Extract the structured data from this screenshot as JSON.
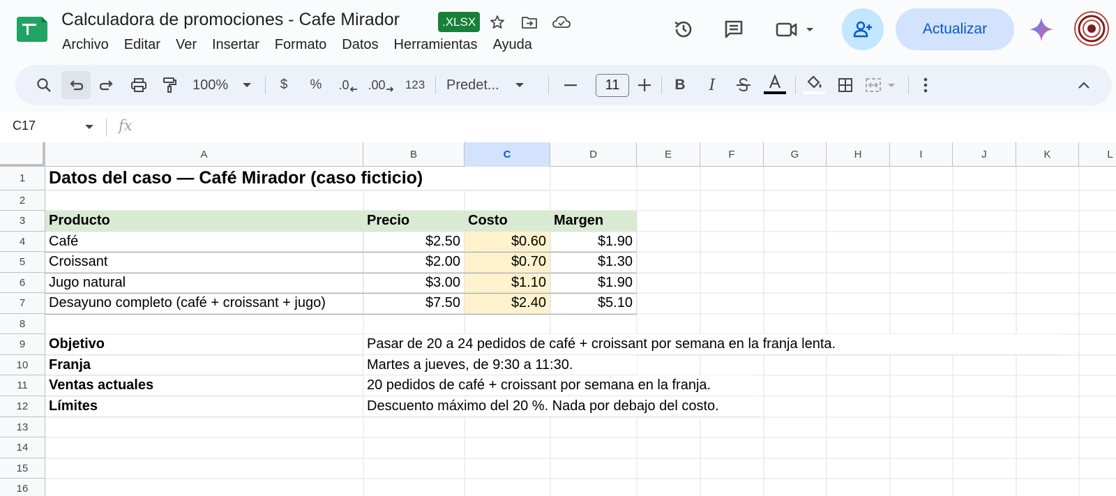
{
  "app": {
    "doc_title": "Calculadora de promociones - Cafe Mirador",
    "file_badge": ".XLSX",
    "menu": [
      "Archivo",
      "Editar",
      "Ver",
      "Insertar",
      "Formato",
      "Datos",
      "Herramientas",
      "Ayuda"
    ],
    "update_label": "Actualizar"
  },
  "toolbar": {
    "zoom": "100%",
    "currency": "$",
    "percent": "%",
    "dec_less": ".0",
    "dec_more": ".00",
    "format_123": "123",
    "font_name": "Predet...",
    "font_size": "11"
  },
  "formula_bar": {
    "name_box": "C17",
    "fx": "fx"
  },
  "sheet": {
    "columns": [
      "A",
      "B",
      "C",
      "D",
      "E",
      "F",
      "G",
      "H",
      "I",
      "J",
      "K",
      "L"
    ],
    "selected_column": "C",
    "rows": [
      "1",
      "2",
      "3",
      "4",
      "5",
      "6",
      "7",
      "8",
      "9",
      "10",
      "11",
      "12",
      "13",
      "14",
      "15",
      "16"
    ],
    "title": "Datos del caso — Café Mirador (caso ficticio)",
    "table_headers": [
      "Producto",
      "Precio",
      "Costo",
      "Margen"
    ],
    "table_rows": [
      [
        "Café",
        "$2.50",
        "$0.60",
        "$1.90"
      ],
      [
        "Croissant",
        "$2.00",
        "$0.70",
        "$1.30"
      ],
      [
        "Jugo natural",
        "$3.00",
        "$1.10",
        "$1.90"
      ],
      [
        "Desayuno completo (café + croissant + jugo)",
        "$7.50",
        "$2.40",
        "$5.10"
      ]
    ],
    "info": [
      [
        "Objetivo",
        "Pasar de 20 a 24 pedidos de café + croissant por semana en la franja lenta."
      ],
      [
        "Franja",
        "Martes a jueves, de 9:30 a 11:30."
      ],
      [
        "Ventas actuales",
        "20 pedidos de café + croissant por semana en la franja."
      ],
      [
        "Límites",
        "Descuento máximo del 20 %. Nada por debajo del costo."
      ]
    ]
  },
  "colors": {
    "header_fill": "#d9ead3",
    "cost_fill": "#fff2cc",
    "accent": "#0b57d0",
    "badge": "#188038"
  }
}
